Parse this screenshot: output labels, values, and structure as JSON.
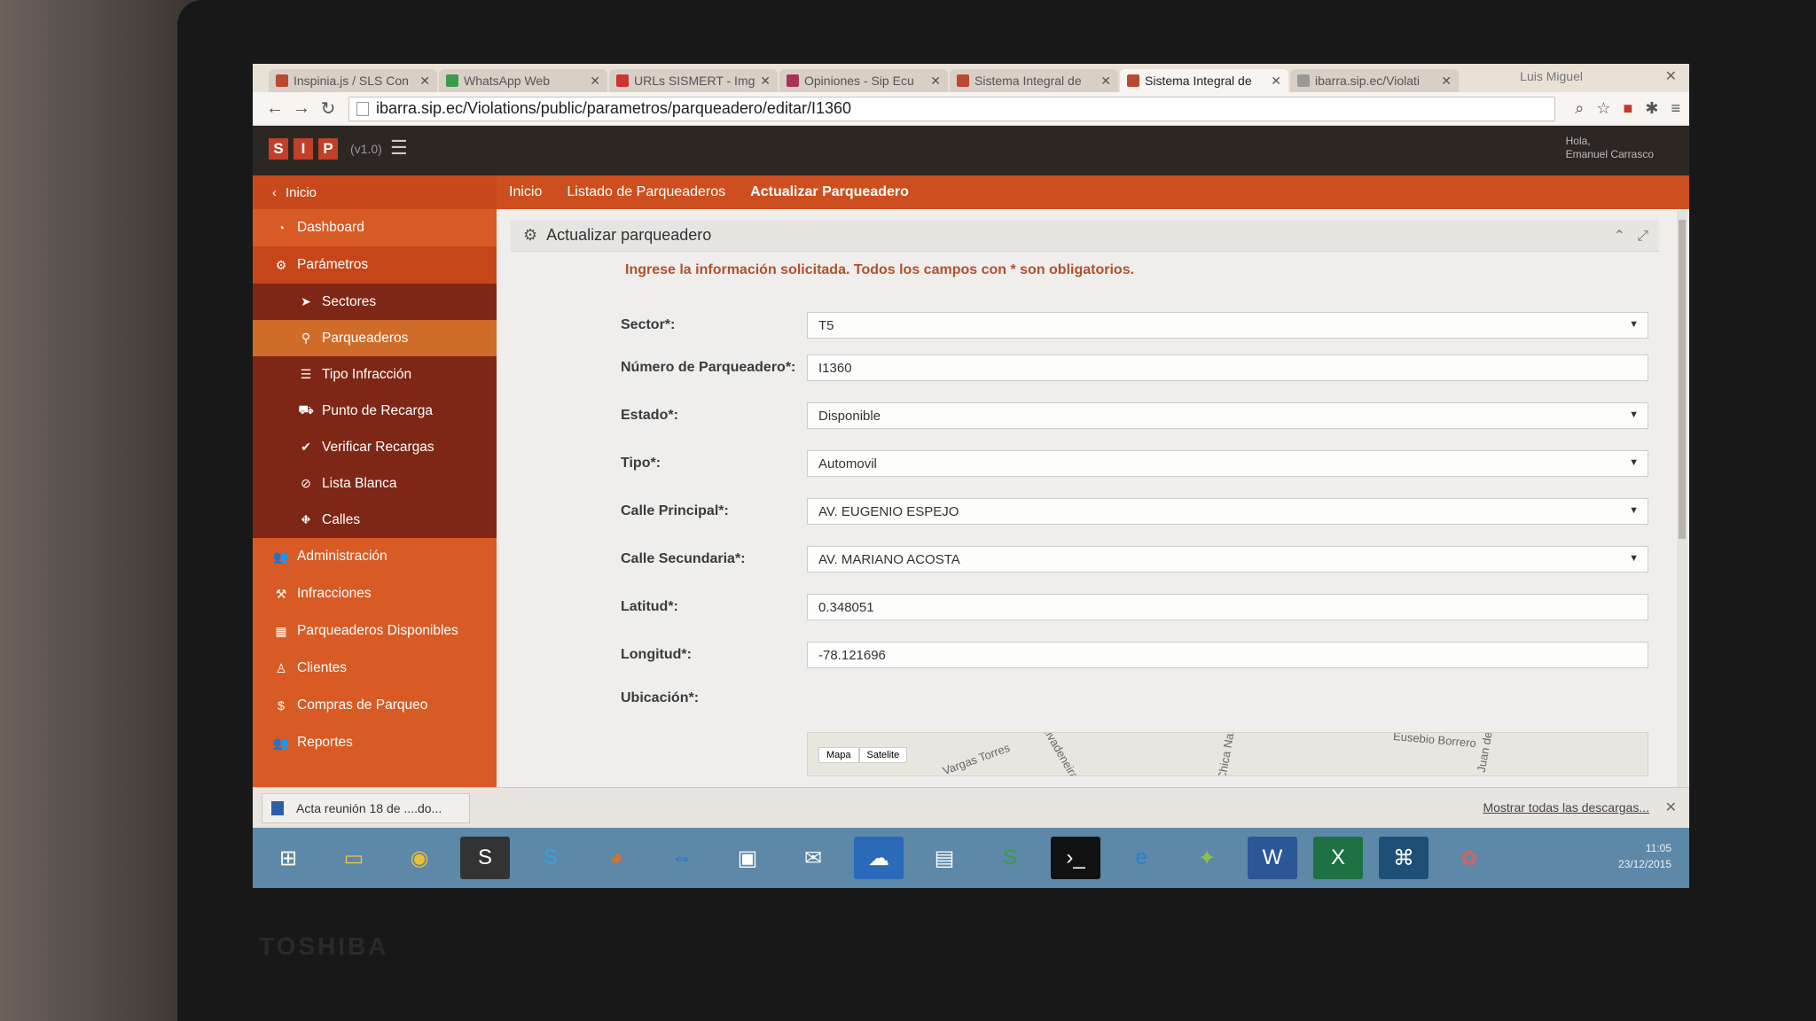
{
  "browser": {
    "tabs": [
      {
        "label": "Inspinia.js / SLS Con",
        "active": false
      },
      {
        "label": "WhatsApp Web",
        "active": false
      },
      {
        "label": "URLs SISMERT - Img",
        "active": false
      },
      {
        "label": "Opiniones - Sip Ecu",
        "active": false
      },
      {
        "label": "Sistema Integral de",
        "active": false
      },
      {
        "label": "Sistema Integral de",
        "active": true
      },
      {
        "label": "ibarra.sip.ec/Violati",
        "active": false
      }
    ],
    "user": "Luis Miguel",
    "url": "ibarra.sip.ec/Violations/public/parametros/parqueadero/editar/I1360"
  },
  "app": {
    "logo": [
      "S",
      "I",
      "P"
    ],
    "version": "(v1.0)",
    "greeting": "Hola,",
    "user_name": "Emanuel Carrasco"
  },
  "sidebar": {
    "back_label": "Inicio",
    "items": [
      {
        "label": "Dashboard",
        "icon": "dashboard-icon",
        "type": "top"
      },
      {
        "label": "Parámetros",
        "icon": "cogs-icon",
        "type": "group"
      },
      {
        "label": "Sectores",
        "icon": "location-arrow-icon",
        "type": "sub"
      },
      {
        "label": "Parqueaderos",
        "icon": "map-marker-icon",
        "type": "sub-active"
      },
      {
        "label": "Tipo Infracción",
        "icon": "list-icon",
        "type": "sub"
      },
      {
        "label": "Punto de Recarga",
        "icon": "cart-icon",
        "type": "sub"
      },
      {
        "label": "Verificar Recargas",
        "icon": "check-icon",
        "type": "sub"
      },
      {
        "label": "Lista Blanca",
        "icon": "ban-icon",
        "type": "sub"
      },
      {
        "label": "Calles",
        "icon": "road-icon",
        "type": "sub"
      },
      {
        "label": "Administración",
        "icon": "users-icon",
        "type": "top"
      },
      {
        "label": "Infracciones",
        "icon": "gavel-icon",
        "type": "top"
      },
      {
        "label": "Parqueaderos Disponibles",
        "icon": "table-icon",
        "type": "top"
      },
      {
        "label": "Clientes",
        "icon": "male-icon",
        "type": "top"
      },
      {
        "label": "Compras de Parqueo",
        "icon": "dollar-icon",
        "type": "top"
      },
      {
        "label": "Reportes",
        "icon": "group-icon",
        "type": "top"
      }
    ]
  },
  "breadcrumb": [
    "Inicio",
    "Listado de Parqueaderos",
    "Actualizar Parqueadero"
  ],
  "panel": {
    "title": "Actualizar parqueadero",
    "notice": "Ingrese la información solicitada. Todos los campos con * son obligatorios."
  },
  "form": {
    "sector": {
      "label": "Sector*:",
      "value": "T5"
    },
    "numero": {
      "label": "Número de Parqueadero*:",
      "value": "I1360"
    },
    "estado": {
      "label": "Estado*:",
      "value": "Disponible"
    },
    "tipo": {
      "label": "Tipo*:",
      "value": "Automovil"
    },
    "calle_principal": {
      "label": "Calle Principal*:",
      "value": "AV. EUGENIO ESPEJO"
    },
    "calle_secundaria": {
      "label": "Calle Secundaria*:",
      "value": "AV. MARIANO ACOSTA"
    },
    "latitud": {
      "label": "Latitud*:",
      "value": "0.348051"
    },
    "longitud": {
      "label": "Longitud*:",
      "value": "-78.121696"
    },
    "ubicacion": {
      "label": "Ubicación*:"
    }
  },
  "map": {
    "tabs": [
      "Mapa",
      "Satelite"
    ],
    "labels": [
      "Vargas Torres",
      "Rivadeneira",
      "Chica Narv",
      "Eusebio Borrero",
      "Juan de"
    ]
  },
  "downloads": {
    "file": "Acta reunión 18 de ....do...",
    "show_all": "Mostrar todas las descargas..."
  },
  "taskbar": {
    "time": "11:05",
    "date": "23/12/2015",
    "apps": [
      "windows-icon",
      "explorer-icon",
      "chrome-icon",
      "sublime-icon",
      "skype-icon",
      "firefox-icon",
      "teamviewer-icon",
      "photos-icon",
      "mail-icon",
      "onedrive-icon",
      "notes-icon",
      "sync-icon",
      "cmd-icon",
      "ie-icon",
      "android-icon",
      "word-icon",
      "excel-icon",
      "mysql-icon",
      "paint-icon"
    ]
  },
  "colors": {
    "sidebar": "#d85a24",
    "sidebar_sub": "#7e2716",
    "active": "#d06c2a",
    "notice": "#b1512b"
  }
}
